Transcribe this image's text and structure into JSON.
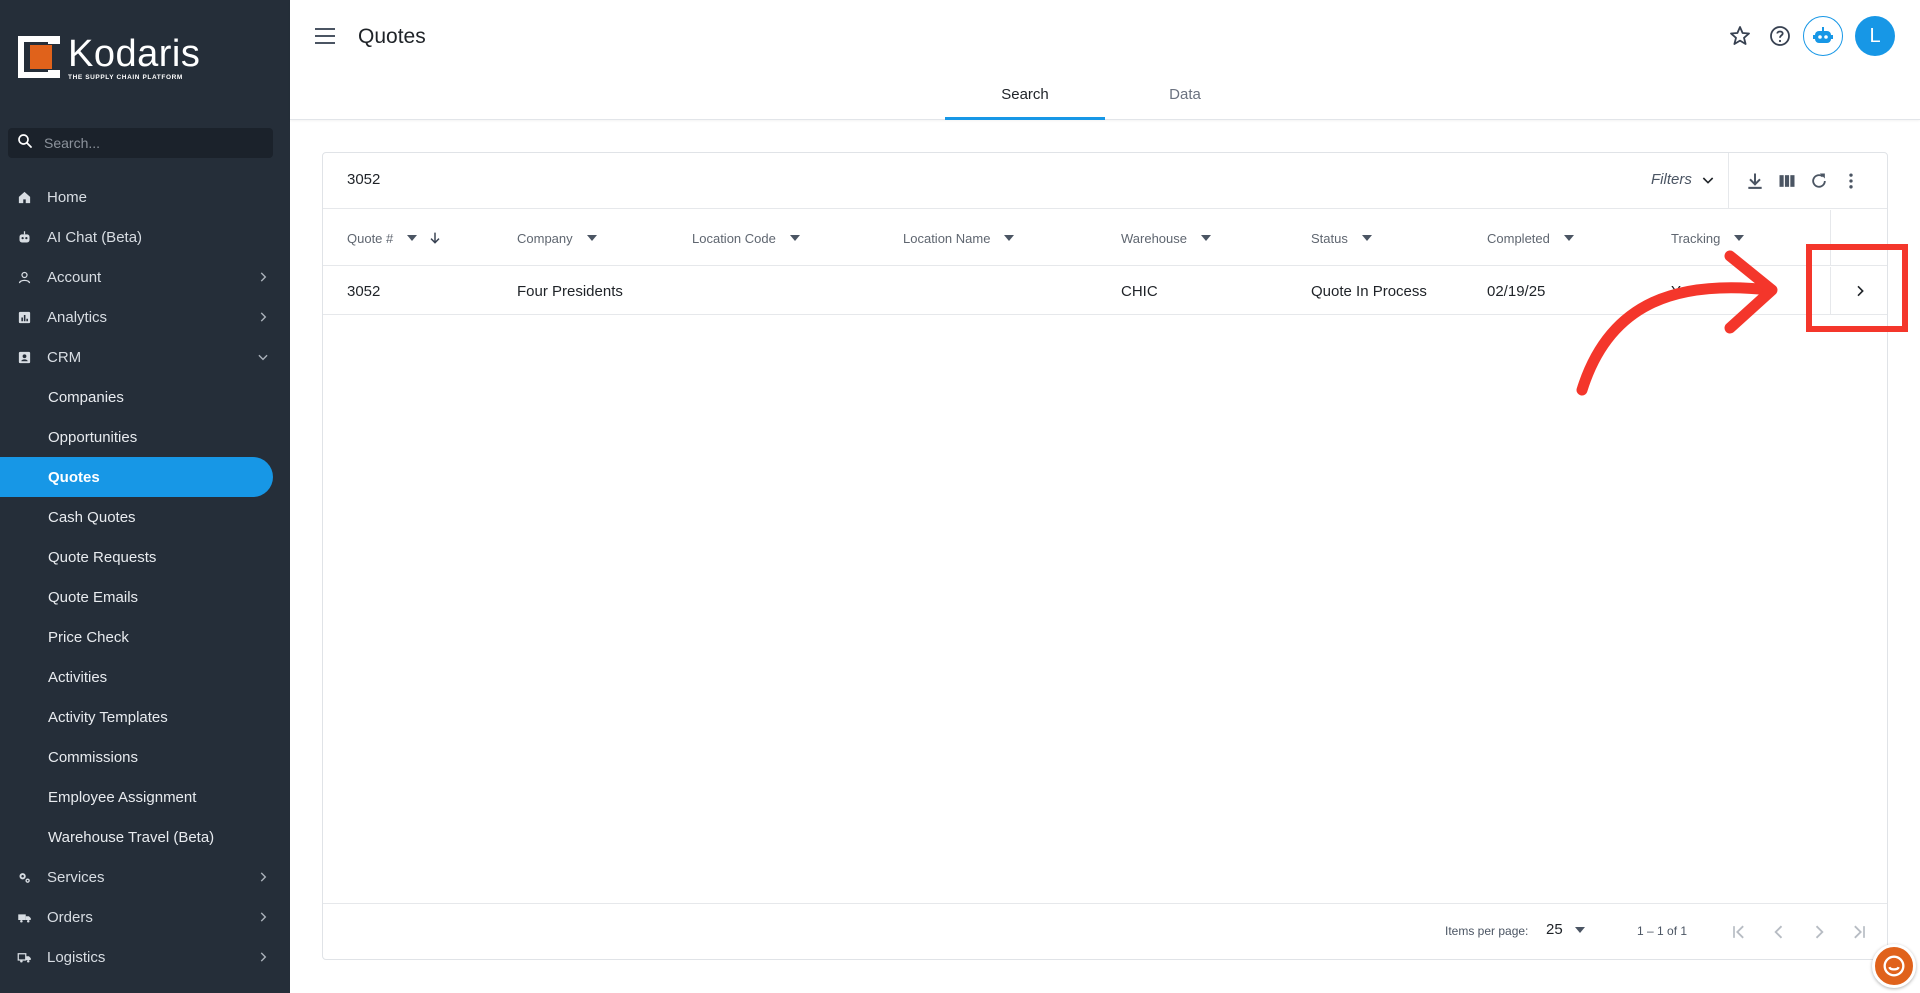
{
  "app": {
    "brand_name": "Kodaris",
    "brand_tagline": "THE SUPPLY CHAIN PLATFORM",
    "accent_color": "#1797e6",
    "brand_orange": "#e0621b",
    "sidebar_bg": "#252e39"
  },
  "sidebar": {
    "search_placeholder": "Search...",
    "items": [
      {
        "label": "Home",
        "icon": "home-icon"
      },
      {
        "label": "AI Chat (Beta)",
        "icon": "robot-icon"
      },
      {
        "label": "Account",
        "icon": "person-icon",
        "expandable": true
      },
      {
        "label": "Analytics",
        "icon": "chart-icon",
        "expandable": true
      },
      {
        "label": "CRM",
        "icon": "contact-card-icon",
        "expandable": true,
        "expanded": true
      }
    ],
    "crm_sub": [
      {
        "label": "Companies"
      },
      {
        "label": "Opportunities"
      },
      {
        "label": "Quotes",
        "active": true
      },
      {
        "label": "Cash Quotes"
      },
      {
        "label": "Quote Requests"
      },
      {
        "label": "Quote Emails"
      },
      {
        "label": "Price Check"
      },
      {
        "label": "Activities"
      },
      {
        "label": "Activity Templates"
      },
      {
        "label": "Commissions"
      },
      {
        "label": "Employee Assignment"
      },
      {
        "label": "Warehouse Travel (Beta)"
      }
    ],
    "bottom_items": [
      {
        "label": "Services",
        "icon": "gears-icon",
        "expandable": true
      },
      {
        "label": "Orders",
        "icon": "truck-icon",
        "expandable": true
      },
      {
        "label": "Logistics",
        "icon": "delivery-truck-icon",
        "expandable": true
      }
    ]
  },
  "header": {
    "title": "Quotes",
    "avatar_initial": "L",
    "tabs": [
      {
        "label": "Search",
        "active": true
      },
      {
        "label": "Data",
        "active": false
      }
    ]
  },
  "table": {
    "search_value": "3052",
    "filters_label": "Filters",
    "columns": [
      "Quote #",
      "Company",
      "Location Code",
      "Location Name",
      "Warehouse",
      "Status",
      "Completed",
      "Tracking"
    ],
    "sort": {
      "column": "Quote #",
      "direction": "descending"
    },
    "rows": [
      {
        "quote": "3052",
        "company": "Four Presidents",
        "location_code": "",
        "location_name": "",
        "warehouse": "CHIC",
        "status": "Quote In Process",
        "completed": "02/19/25",
        "tracking": "Yes"
      }
    ],
    "paginator": {
      "items_per_page_label": "Items per page:",
      "items_per_page": "25",
      "range": "1 – 1 of 1"
    }
  },
  "annotation": {
    "color": "#f4362b",
    "target": "row-open-button"
  }
}
